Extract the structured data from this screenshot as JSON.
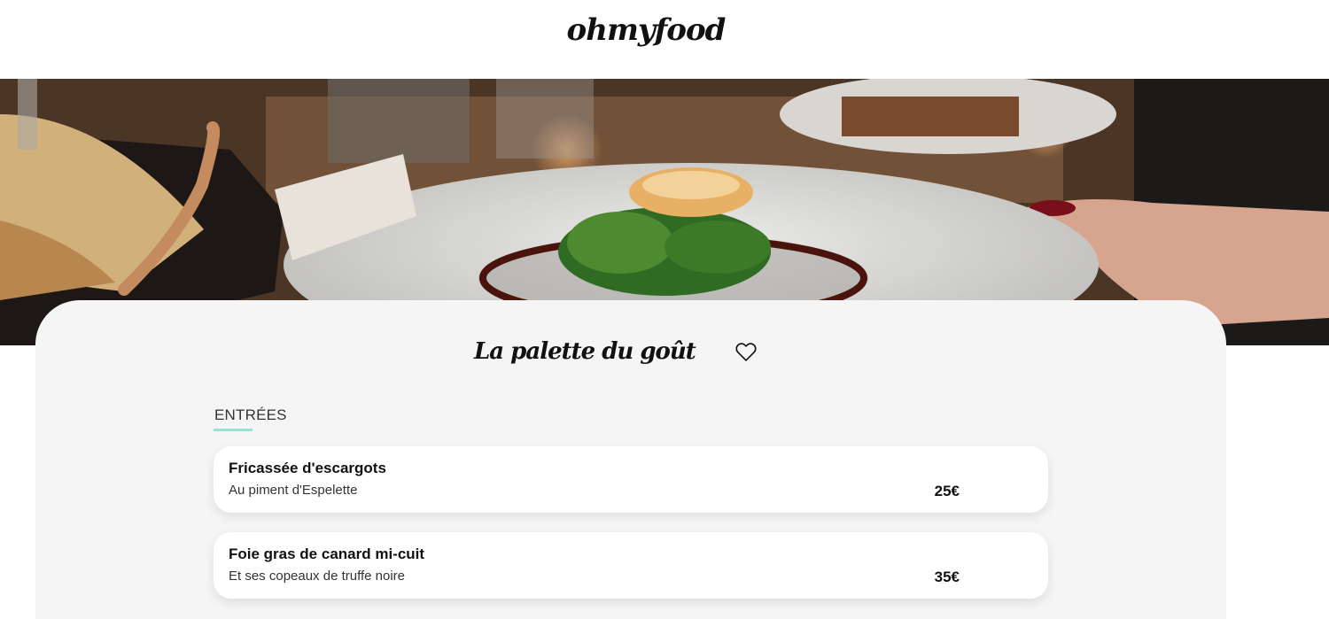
{
  "header": {
    "logo": "ohmyfood"
  },
  "hero": {
    "image": "restaurant-plate-photo"
  },
  "restaurant": {
    "name": "La palette du goût",
    "favorite_icon": "heart-outline-icon"
  },
  "menu": {
    "section_title": "ENTRÉES",
    "accent_color": "#99e2d0",
    "dishes": [
      {
        "name": "Fricassée d'escargots",
        "description": "Au piment d'Espelette",
        "price": "25€"
      },
      {
        "name": "Foie gras de canard mi-cuit",
        "description": "Et ses copeaux de truffe noire",
        "price": "35€"
      }
    ]
  }
}
